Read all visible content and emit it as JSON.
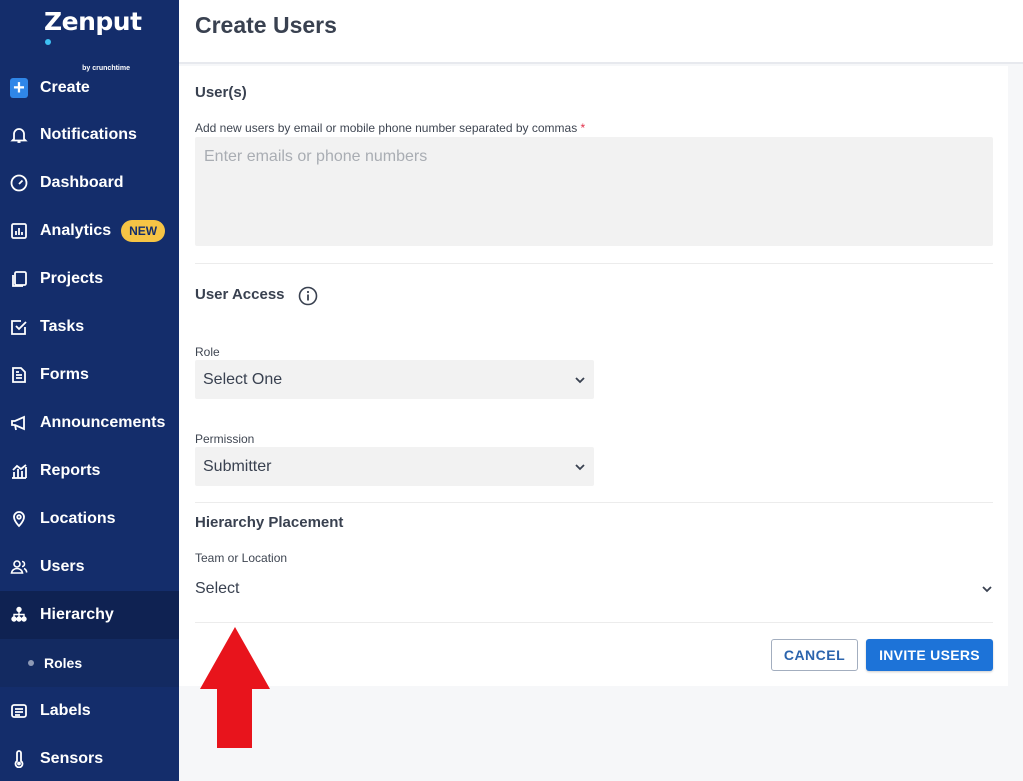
{
  "brand": {
    "name": "Zenput",
    "byline": "by crunchtime"
  },
  "sidebar": {
    "items": [
      {
        "label": "Create",
        "icon": "plus-icon"
      },
      {
        "label": "Notifications",
        "icon": "bell-icon"
      },
      {
        "label": "Dashboard",
        "icon": "gauge-icon"
      },
      {
        "label": "Analytics",
        "icon": "chart-icon",
        "badge": "NEW"
      },
      {
        "label": "Projects",
        "icon": "projects-icon"
      },
      {
        "label": "Tasks",
        "icon": "checkbox-icon"
      },
      {
        "label": "Forms",
        "icon": "document-icon"
      },
      {
        "label": "Announcements",
        "icon": "megaphone-icon"
      },
      {
        "label": "Reports",
        "icon": "report-icon"
      },
      {
        "label": "Locations",
        "icon": "pin-icon"
      },
      {
        "label": "Users",
        "icon": "users-icon"
      },
      {
        "label": "Hierarchy",
        "icon": "hierarchy-icon",
        "active": true
      },
      {
        "label": "Roles",
        "sub": true
      },
      {
        "label": "Labels",
        "icon": "label-icon"
      },
      {
        "label": "Sensors",
        "icon": "thermometer-icon"
      }
    ]
  },
  "header": {
    "title": "Create Users"
  },
  "form": {
    "users_section": "User(s)",
    "users_label": "Add new users by email or mobile phone number separated by commas",
    "required_mark": "*",
    "users_placeholder": "Enter emails or phone numbers",
    "users_value": "",
    "access_section": "User Access",
    "role_label": "Role",
    "role_value": "Select One",
    "permission_label": "Permission",
    "permission_value": "Submitter",
    "hierarchy_section": "Hierarchy Placement",
    "team_label": "Team or Location",
    "team_value": "Select"
  },
  "actions": {
    "cancel": "CANCEL",
    "invite": "INVITE USERS"
  },
  "colors": {
    "sidebar": "#142d6b",
    "accent": "#1d73d8",
    "badge": "#f6c445",
    "arrow": "#e8141c"
  }
}
